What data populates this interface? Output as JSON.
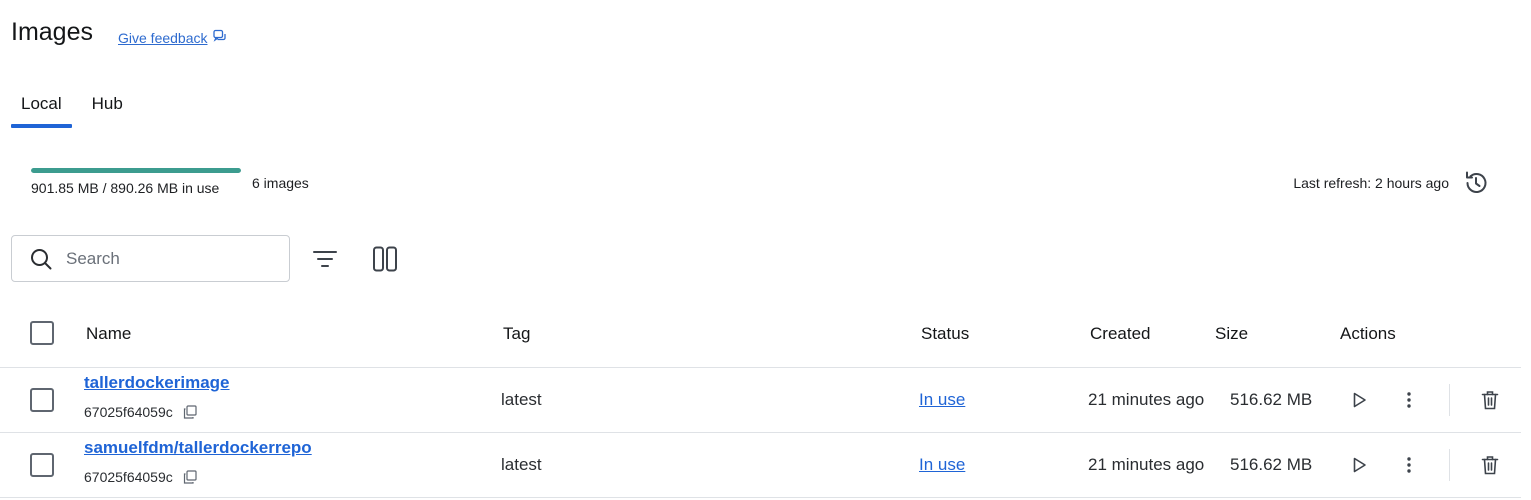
{
  "header": {
    "title": "Images",
    "feedback_label": "Give feedback"
  },
  "tabs": [
    {
      "label": "Local",
      "active": true
    },
    {
      "label": "Hub",
      "active": false
    }
  ],
  "usage": {
    "text": "901.85 MB / 890.26 MB in use",
    "images_count": "6 images",
    "fraction_filled": 1.0,
    "bar_color": "#3c9c8f"
  },
  "refresh": {
    "label": "Last refresh: 2 hours ago",
    "icon": "refresh-icon"
  },
  "search": {
    "placeholder": "Search",
    "value": ""
  },
  "toolbar": {
    "filter_icon": "filter-icon",
    "columns_icon": "columns-icon"
  },
  "table": {
    "columns": {
      "name": "Name",
      "tag": "Tag",
      "status": "Status",
      "created": "Created",
      "size": "Size",
      "actions": "Actions"
    },
    "rows": [
      {
        "name": "tallerdockerimage",
        "id": "67025f64059c",
        "tag": "latest",
        "status": "In use",
        "created": "21 minutes ago",
        "size": "516.62 MB"
      },
      {
        "name": "samuelfdm/tallerdockerrepo",
        "id": "67025f64059c",
        "tag": "latest",
        "status": "In use",
        "created": "21 minutes ago",
        "size": "516.62 MB"
      }
    ]
  },
  "colors": {
    "accent": "#1f64d6",
    "usage_bar": "#3c9c8f",
    "divider": "#dfe2e6"
  }
}
